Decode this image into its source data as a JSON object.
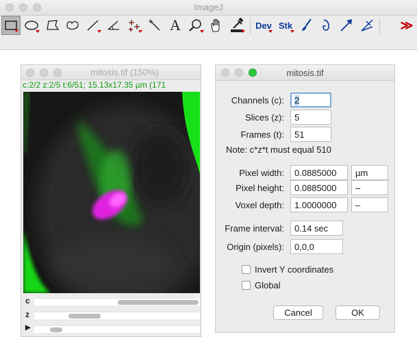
{
  "imagej": {
    "title": "ImageJ",
    "tools": [
      "rectangle-tool",
      "oval-tool",
      "polygon-tool",
      "freehand-tool",
      "line-tool",
      "angle-tool",
      "multipoint-tool",
      "wand-tool",
      "text-tool",
      "magnifier-tool",
      "hand-tool",
      "eyedropper-tool",
      "dev-menu",
      "stk-menu",
      "brush-tool",
      "pencil-tool",
      "arrow-tool",
      "angle-measure-tool",
      "more-tools"
    ],
    "dev_label": "Dev",
    "stk_label": "Stk",
    "text_tool_label": "A",
    "more_label": "≫"
  },
  "image_window": {
    "title": "mitosis.tif (150%)",
    "info": "c:2/2 z:2/5 t:6/51; 15.13x17.35 µm (171",
    "sliders": [
      {
        "label": "c",
        "position": 0.55
      },
      {
        "label": "z",
        "position": 0.25
      },
      {
        "label": "▶",
        "position": 0.12
      }
    ]
  },
  "dialog": {
    "title": "mitosis.tif",
    "channels_label": "Channels (c):",
    "channels_value": "2",
    "slices_label": "Slices (z):",
    "slices_value": "5",
    "frames_label": "Frames (t):",
    "frames_value": "51",
    "note": "Note: c*z*t must equal 510",
    "pixel_width_label": "Pixel width:",
    "pixel_width_value": "0.0885000",
    "pixel_width_unit": "µm",
    "pixel_height_label": "Pixel height:",
    "pixel_height_value": "0.0885000",
    "pixel_height_unit": "–",
    "voxel_depth_label": "Voxel depth:",
    "voxel_depth_value": "1.0000000",
    "voxel_depth_unit": "–",
    "frame_interval_label": "Frame interval:",
    "frame_interval_value": "0.14 sec",
    "origin_label": "Origin (pixels):",
    "origin_value": "0,0,0",
    "invert_y_label": "Invert Y coordinates",
    "invert_y_checked": false,
    "global_label": "Global",
    "global_checked": false,
    "cancel_label": "Cancel",
    "ok_label": "OK"
  },
  "colors": {
    "info_text": "#119a11",
    "green_channel": "#22cc22",
    "magenta_channel": "#ff2aff",
    "focus_ring": "#7fa6d9",
    "selection_highlight": "#b5d3f4"
  }
}
